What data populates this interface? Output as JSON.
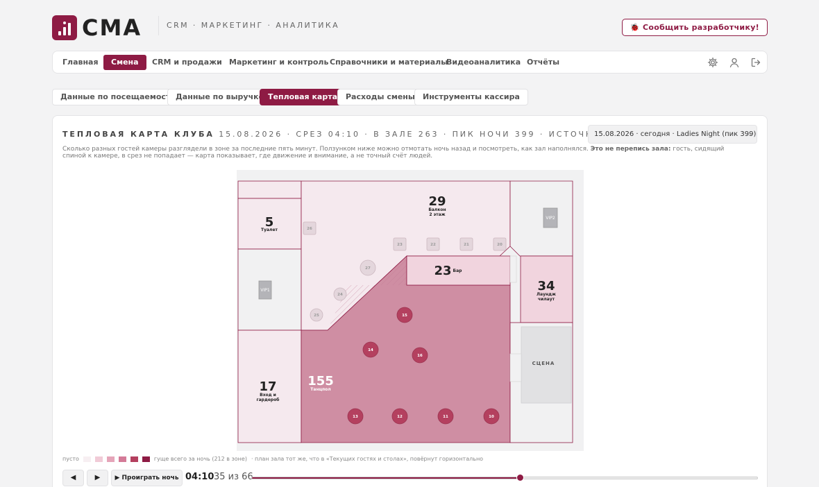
{
  "app": {
    "logo_text": "CMA",
    "topnav": "CRM · МАРКЕТИНГ · АНАЛИТИКА",
    "report_button": "🐞 Сообщить разработчику!"
  },
  "mainnav": {
    "items": [
      "Главная",
      "Смена",
      "CRM и продажи",
      "Маркетинг и контроль",
      "Справочники и материалы",
      "Видеоаналитика",
      "Отчёты"
    ],
    "active": "Смена",
    "icons": [
      "gear-icon",
      "user-icon",
      "logout-icon"
    ]
  },
  "subtabs": {
    "items": [
      "Данные по посещаемости",
      "Данные по выручке",
      "Тепловая карта",
      "Расходы смены",
      "Инструменты кассира"
    ],
    "active": "Тепловая карта"
  },
  "heatmap": {
    "heading_title": "ТЕПЛОВАЯ КАРТА КЛУБА",
    "heading_rest": " 15.08.2026 · СРЕЗ 04:10 · В ЗАЛЕ 263 · ПИК НОЧИ 399 · ИСТОЧНИК: ТАБЛИЦА СРЕЗА",
    "selector": "15.08.2026 · сегодня · Ladies Night (пик 399)",
    "description_start": "Сколько разных гостей камеры разглядели в зоне за последние пять минут. Ползунком ниже можно отмотать ночь назад и посмотреть, как зал наполнялся. ",
    "description_bold": "Это не перепись зала:",
    "description_end": " гость, сидящий спиной к камере, в срез не попадает — карта показывает, где движение и внимание, а не точный счёт людей.",
    "zones": [
      {
        "key": "balcony",
        "count": "29",
        "label": "Балкон",
        "sublabel": "2 этаж",
        "level": 1
      },
      {
        "key": "toilet",
        "count": "5",
        "label": "Туалет",
        "level": 1
      },
      {
        "key": "bar",
        "count": "23",
        "label": "Бар",
        "level": 2
      },
      {
        "key": "lounge",
        "count": "34",
        "label": "Лаундж",
        "sublabel": "чилаут",
        "level": 2
      },
      {
        "key": "entrance",
        "count": "17",
        "label": "Вход и",
        "sublabel": "гардероб",
        "level": 1
      },
      {
        "key": "dancefloor",
        "count": "155",
        "label": "Танцпол",
        "level": 5
      }
    ],
    "stage_label": "СЦЕНА",
    "vip_labels": [
      "VIP1",
      "VIP2"
    ],
    "tables": [
      "26",
      "23",
      "22",
      "21",
      "20",
      "27",
      "24",
      "25",
      "15",
      "14",
      "16",
      "13",
      "12",
      "11",
      "10"
    ],
    "legend": {
      "empty_label": "пусто",
      "dense_label": "гуще всего за ночь (212 в зоне)",
      "note": "· план зала тот же, что в «Текущих гостях и столах», повёрнут горизонтально",
      "colors": [
        "#f7eff2",
        "#f1cbd7",
        "#e5a5b9",
        "#d47b98",
        "#b4405f",
        "#8e1b44"
      ]
    },
    "zone_colors": [
      "#f1f1f2",
      "#f5e9ee",
      "#f1d4de",
      "#e6b0c2",
      "#d99aae",
      "#cf8ea3"
    ],
    "player": {
      "back": "◀",
      "forward": "▶",
      "play": "▶ Проиграть ночь",
      "time": "04:10",
      "count": "35 из 66",
      "step": 35,
      "total": 66
    }
  }
}
